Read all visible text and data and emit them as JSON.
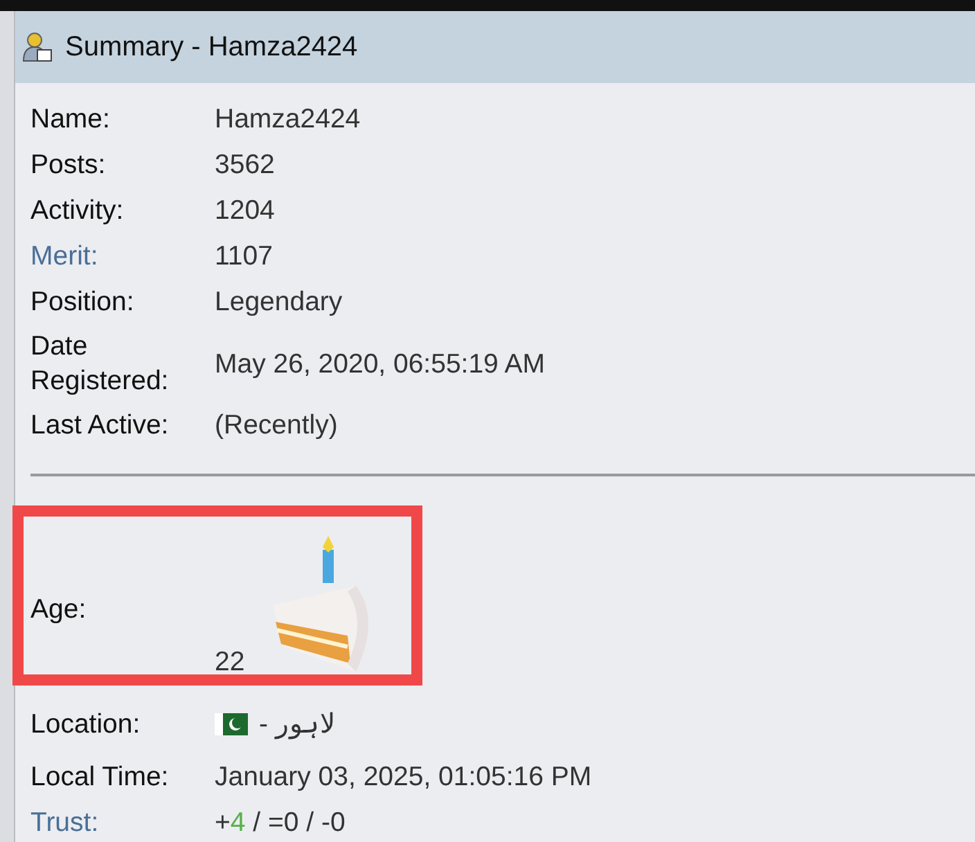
{
  "panel": {
    "title": "Summary - Hamza2424"
  },
  "rows": [
    {
      "kind": "text",
      "label": "Name:",
      "value": "Hamza2424"
    },
    {
      "kind": "text",
      "label": "Posts:",
      "value": "3562"
    },
    {
      "kind": "text",
      "label": "Activity:",
      "value": "1204"
    },
    {
      "kind": "link",
      "label": "Merit:",
      "value": "1107"
    },
    {
      "kind": "text",
      "label": "Position:",
      "value": "Legendary"
    },
    {
      "kind": "text",
      "label": "Date Registered:",
      "value": "May 26, 2020, 06:55:19 AM"
    },
    {
      "kind": "text",
      "label": "Last Active:",
      "value": "(Recently)"
    }
  ],
  "rows2": [
    {
      "kind": "age",
      "label": "Age:",
      "value": "22"
    },
    {
      "kind": "location",
      "label": "Location:",
      "value": "لاہور -"
    },
    {
      "kind": "text",
      "label": "Local Time:",
      "value": "January 03, 2025, 01:05:16 PM"
    },
    {
      "kind": "trust",
      "label": "Trust:",
      "parts": [
        {
          "kind": "plain",
          "text": "+"
        },
        {
          "kind": "positive",
          "text": "4"
        },
        {
          "kind": "plain",
          "text": " / =0 / -0"
        }
      ]
    }
  ],
  "highlight": {
    "color": "#f04848"
  }
}
